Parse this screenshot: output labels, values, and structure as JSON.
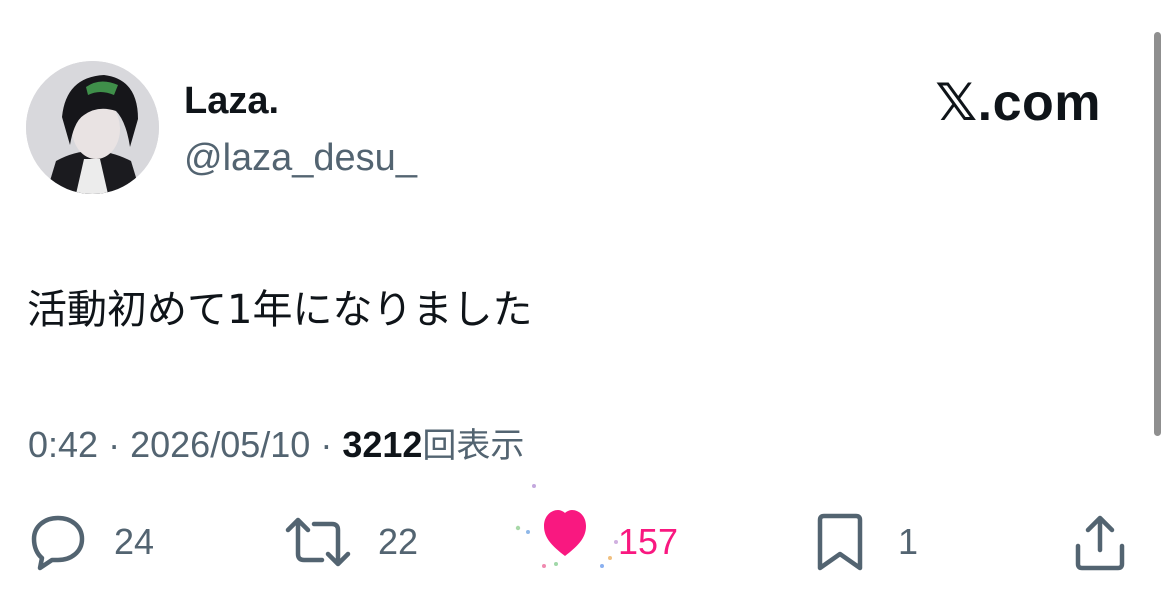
{
  "user": {
    "display_name": "Laza.",
    "handle": "@laza_desu_"
  },
  "brand": "𝕏.com",
  "tweet": {
    "text": "活動初めて1年になりました",
    "time": "0:42",
    "date": "2026/05/10",
    "separator": "·",
    "views_count": "3212",
    "views_label": "回表示"
  },
  "actions": {
    "reply_count": "24",
    "retweet_count": "22",
    "like_count": "157",
    "bookmark_count": "1"
  },
  "colors": {
    "like": "#f91880",
    "secondary_text": "#536471",
    "primary_text": "#0f1419"
  },
  "icons": [
    "reply-icon",
    "retweet-icon",
    "heart-icon",
    "bookmark-icon",
    "share-icon"
  ]
}
